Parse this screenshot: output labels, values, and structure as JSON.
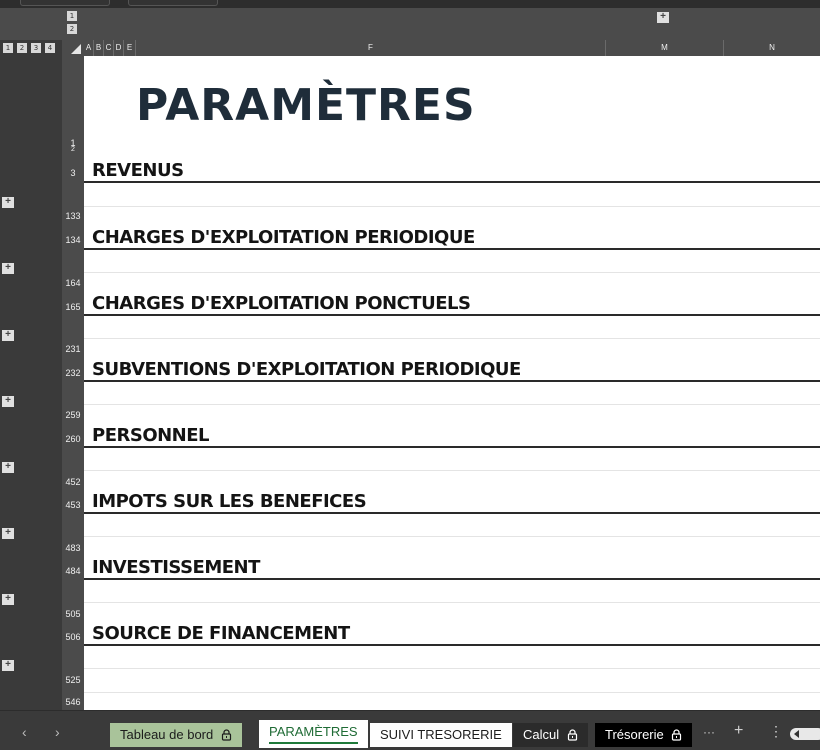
{
  "column_outline": {
    "levels": [
      "1",
      "2"
    ],
    "expand_symbol": "+"
  },
  "row_outline": {
    "levels": [
      "1",
      "2",
      "3",
      "4"
    ],
    "expand_symbol": "+"
  },
  "column_headers": [
    "A",
    "B",
    "C",
    "D",
    "E",
    "F",
    "M",
    "N"
  ],
  "row_numbers": [
    "1",
    "2",
    "3",
    "133",
    "134",
    "164",
    "165",
    "231",
    "232",
    "259",
    "260",
    "452",
    "453",
    "483",
    "484",
    "505",
    "506",
    "525",
    "546"
  ],
  "sheet": {
    "title": "PARAMÈTRES",
    "sections": [
      "REVENUS",
      "CHARGES D'EXPLOITATION PERIODIQUE",
      "CHARGES D'EXPLOITATION PONCTUELS",
      "SUBVENTIONS D'EXPLOITATION PERIODIQUE",
      "PERSONNEL",
      "IMPOTS SUR LES BENEFICES",
      "INVESTISSEMENT",
      "SOURCE DE FINANCEMENT"
    ]
  },
  "tabs": [
    {
      "label": "Tableau de bord",
      "locked": true,
      "color": "#a9c39a"
    },
    {
      "label": "PARAMÈTRES",
      "locked": false,
      "active": true,
      "color": "#ffffff"
    },
    {
      "label": "SUIVI TRESORERIE",
      "locked": false,
      "color": "#ffffff"
    },
    {
      "label": "Calcul",
      "locked": true,
      "color": "#2b2b2b"
    },
    {
      "label": "Trésorerie",
      "locked": true,
      "color": "#000000"
    }
  ],
  "tab_controls": {
    "prev": "‹",
    "next": "›",
    "more": "···",
    "add": "+",
    "options": "⋮"
  },
  "colors": {
    "header_bg": "#4b4b4b",
    "title_color": "#1f2d3a",
    "active_tab_accent": "#1f7a3a"
  }
}
